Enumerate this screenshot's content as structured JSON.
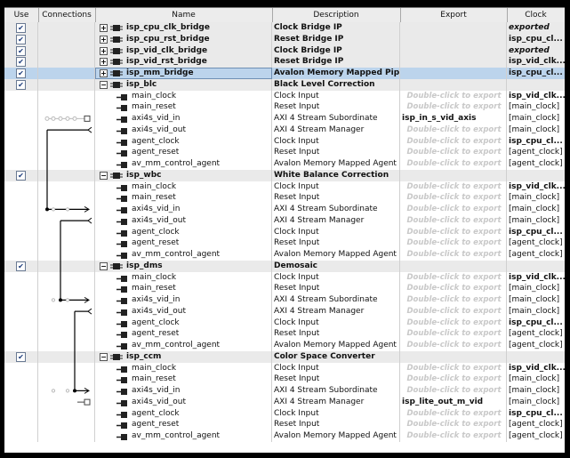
{
  "columns": {
    "use": "Use",
    "connections": "Connections",
    "name": "Name",
    "description": "Description",
    "export": "Export",
    "clock": "Clock"
  },
  "hint": "Double-click to export",
  "rows": [
    {
      "kind": "comp",
      "expand": "+",
      "use": true,
      "name": "isp_cpu_clk_bridge",
      "desc": "Clock Bridge IP",
      "export": "",
      "clock": "exported",
      "clock_style": "i"
    },
    {
      "kind": "comp",
      "expand": "+",
      "use": true,
      "name": "isp_cpu_rst_bridge",
      "desc": "Reset Bridge IP",
      "export": "",
      "clock": "isp_cpu_cl...",
      "clock_style": "b"
    },
    {
      "kind": "comp",
      "expand": "+",
      "use": true,
      "name": "isp_vid_clk_bridge",
      "desc": "Clock Bridge IP",
      "export": "",
      "clock": "exported",
      "clock_style": "i"
    },
    {
      "kind": "comp",
      "expand": "+",
      "use": true,
      "name": "isp_vid_rst_bridge",
      "desc": "Reset Bridge IP",
      "export": "",
      "clock": "isp_vid_clk...",
      "clock_style": "b"
    },
    {
      "kind": "comp",
      "expand": "+",
      "use": true,
      "selected": true,
      "name": "isp_mm_bridge",
      "desc": "Avalon Memory Mapped Pipeli...",
      "export": "",
      "clock": "isp_cpu_cl...",
      "clock_style": "b"
    },
    {
      "kind": "comp",
      "expand": "−",
      "use": true,
      "name": "isp_blc",
      "desc": "Black Level Correction",
      "export": "",
      "clock": "",
      "clock_style": ""
    },
    {
      "kind": "port",
      "name": "main_clock",
      "desc": "Clock Input",
      "export": "",
      "hint": true,
      "clock": "isp_vid_clk...",
      "clock_style": "b"
    },
    {
      "kind": "port",
      "name": "main_reset",
      "desc": "Reset Input",
      "export": "",
      "hint": true,
      "clock": "[main_clock]",
      "clock_style": ""
    },
    {
      "kind": "port",
      "name": "axi4s_vid_in",
      "desc": "AXI 4 Stream Subordinate",
      "export": "isp_in_s_vid_axis",
      "hint": false,
      "clock": "[main_clock]",
      "clock_style": ""
    },
    {
      "kind": "port",
      "name": "axi4s_vid_out",
      "desc": "AXI 4 Stream Manager",
      "export": "",
      "hint": true,
      "clock": "[main_clock]",
      "clock_style": ""
    },
    {
      "kind": "port",
      "name": "agent_clock",
      "desc": "Clock Input",
      "export": "",
      "hint": true,
      "clock": "isp_cpu_cl...",
      "clock_style": "b"
    },
    {
      "kind": "port",
      "name": "agent_reset",
      "desc": "Reset Input",
      "export": "",
      "hint": true,
      "clock": "[agent_clock]",
      "clock_style": ""
    },
    {
      "kind": "port",
      "name": "av_mm_control_agent",
      "desc": "Avalon Memory Mapped Agent",
      "export": "",
      "hint": true,
      "clock": "[agent_clock]",
      "clock_style": ""
    },
    {
      "kind": "comp",
      "expand": "−",
      "use": true,
      "name": "isp_wbc",
      "desc": "White Balance Correction",
      "export": "",
      "clock": "",
      "clock_style": ""
    },
    {
      "kind": "port",
      "name": "main_clock",
      "desc": "Clock Input",
      "export": "",
      "hint": true,
      "clock": "isp_vid_clk...",
      "clock_style": "b"
    },
    {
      "kind": "port",
      "name": "main_reset",
      "desc": "Reset Input",
      "export": "",
      "hint": true,
      "clock": "[main_clock]",
      "clock_style": ""
    },
    {
      "kind": "port",
      "name": "axi4s_vid_in",
      "desc": "AXI 4 Stream Subordinate",
      "export": "",
      "hint": true,
      "clock": "[main_clock]",
      "clock_style": ""
    },
    {
      "kind": "port",
      "name": "axi4s_vid_out",
      "desc": "AXI 4 Stream Manager",
      "export": "",
      "hint": true,
      "clock": "[main_clock]",
      "clock_style": ""
    },
    {
      "kind": "port",
      "name": "agent_clock",
      "desc": "Clock Input",
      "export": "",
      "hint": true,
      "clock": "isp_cpu_cl...",
      "clock_style": "b"
    },
    {
      "kind": "port",
      "name": "agent_reset",
      "desc": "Reset Input",
      "export": "",
      "hint": true,
      "clock": "[agent_clock]",
      "clock_style": ""
    },
    {
      "kind": "port",
      "name": "av_mm_control_agent",
      "desc": "Avalon Memory Mapped Agent",
      "export": "",
      "hint": true,
      "clock": "[agent_clock]",
      "clock_style": ""
    },
    {
      "kind": "comp",
      "expand": "−",
      "use": true,
      "name": "isp_dms",
      "desc": "Demosaic",
      "export": "",
      "clock": "",
      "clock_style": ""
    },
    {
      "kind": "port",
      "name": "main_clock",
      "desc": "Clock Input",
      "export": "",
      "hint": true,
      "clock": "isp_vid_clk...",
      "clock_style": "b"
    },
    {
      "kind": "port",
      "name": "main_reset",
      "desc": "Reset Input",
      "export": "",
      "hint": true,
      "clock": "[main_clock]",
      "clock_style": ""
    },
    {
      "kind": "port",
      "name": "axi4s_vid_in",
      "desc": "AXI 4 Stream Subordinate",
      "export": "",
      "hint": true,
      "clock": "[main_clock]",
      "clock_style": ""
    },
    {
      "kind": "port",
      "name": "axi4s_vid_out",
      "desc": "AXI 4 Stream Manager",
      "export": "",
      "hint": true,
      "clock": "[main_clock]",
      "clock_style": ""
    },
    {
      "kind": "port",
      "name": "agent_clock",
      "desc": "Clock Input",
      "export": "",
      "hint": true,
      "clock": "isp_cpu_cl...",
      "clock_style": "b"
    },
    {
      "kind": "port",
      "name": "agent_reset",
      "desc": "Reset Input",
      "export": "",
      "hint": true,
      "clock": "[agent_clock]",
      "clock_style": ""
    },
    {
      "kind": "port",
      "name": "av_mm_control_agent",
      "desc": "Avalon Memory Mapped Agent",
      "export": "",
      "hint": true,
      "clock": "[agent_clock]",
      "clock_style": ""
    },
    {
      "kind": "comp",
      "expand": "−",
      "use": true,
      "name": "isp_ccm",
      "desc": "Color Space Converter",
      "export": "",
      "clock": "",
      "clock_style": ""
    },
    {
      "kind": "port",
      "name": "main_clock",
      "desc": "Clock Input",
      "export": "",
      "hint": true,
      "clock": "isp_vid_clk...",
      "clock_style": "b"
    },
    {
      "kind": "port",
      "name": "main_reset",
      "desc": "Reset Input",
      "export": "",
      "hint": true,
      "clock": "[main_clock]",
      "clock_style": ""
    },
    {
      "kind": "port",
      "name": "axi4s_vid_in",
      "desc": "AXI 4 Stream Subordinate",
      "export": "",
      "hint": true,
      "clock": "[main_clock]",
      "clock_style": ""
    },
    {
      "kind": "port",
      "name": "axi4s_vid_out",
      "desc": "AXI 4 Stream Manager",
      "export": "isp_lite_out_m_vid",
      "hint": false,
      "clock": "[main_clock]",
      "clock_style": ""
    },
    {
      "kind": "port",
      "name": "agent_clock",
      "desc": "Clock Input",
      "export": "",
      "hint": true,
      "clock": "isp_cpu_cl...",
      "clock_style": "b"
    },
    {
      "kind": "port",
      "name": "agent_reset",
      "desc": "Reset Input",
      "export": "",
      "hint": true,
      "clock": "[agent_clock]",
      "clock_style": ""
    },
    {
      "kind": "port",
      "name": "av_mm_control_agent",
      "desc": "Avalon Memory Mapped Agent",
      "export": "",
      "hint": true,
      "clock": "[agent_clock]",
      "clock_style": ""
    }
  ]
}
